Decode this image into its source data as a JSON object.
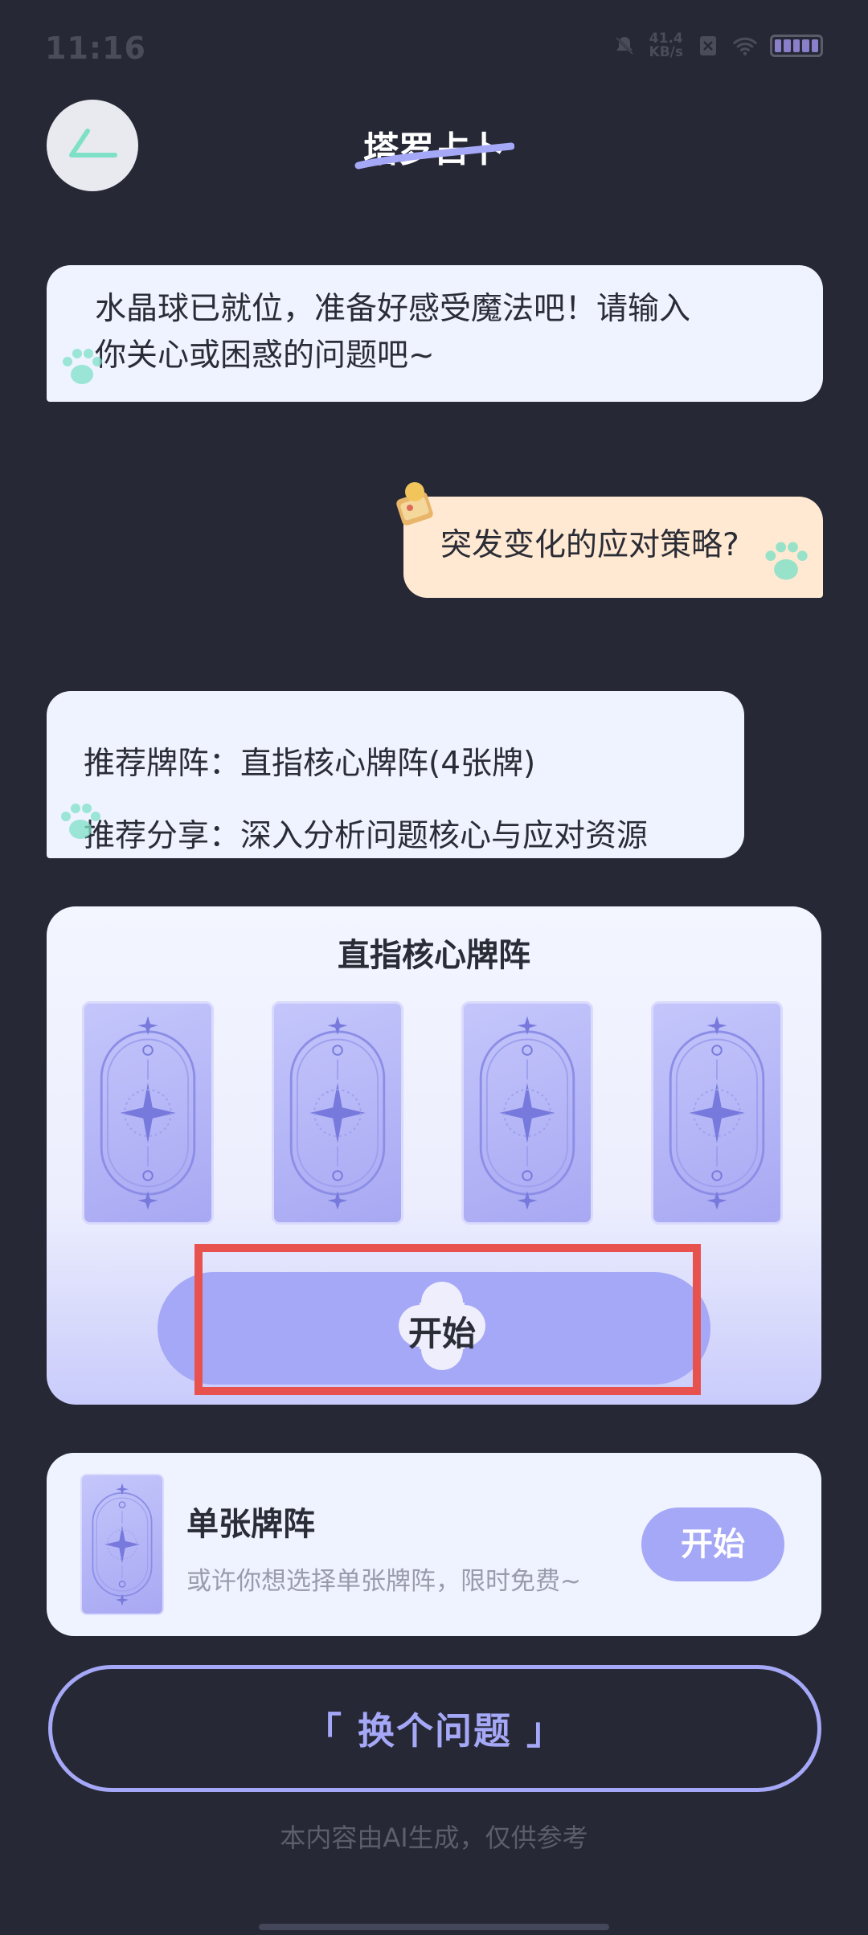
{
  "status_bar": {
    "time": "11:16",
    "net_speed_value": "41.4",
    "net_speed_unit": "KB/s"
  },
  "header": {
    "title": "塔罗占卜"
  },
  "chat": {
    "ai_message_1": [
      "水晶球已就位，准备好感受魔法吧！请输入",
      "你关心或困惑的问题吧~"
    ],
    "user_message": "突发变化的应对策略?",
    "ai_message_2": [
      "推荐牌阵：直指核心牌阵(4张牌)",
      "推荐分享：深入分析问题核心与应对资源"
    ]
  },
  "spread": {
    "title": "直指核心牌阵",
    "card_count": 4,
    "start_label": "开始"
  },
  "single_spread": {
    "title": "单张牌阵",
    "description": "或许你想选择单张牌阵，限时免费~",
    "start_label": "开始"
  },
  "change_question_label": "「  换个问题  」",
  "footer_note": "本内容由AI生成，仅供参考",
  "colors": {
    "background": "#262835",
    "accent": "#a5a7f7",
    "ai_bubble": "#eef3ff",
    "user_bubble": "#ffe9d2",
    "highlight": "#e8524e",
    "paw": "#7fe0c8"
  }
}
